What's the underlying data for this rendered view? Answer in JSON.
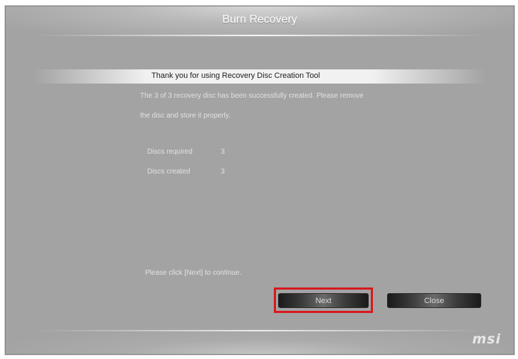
{
  "window": {
    "title": "Burn Recovery"
  },
  "content": {
    "heading": "Thank you for using Recovery Disc Creation Tool",
    "message_line1": "The 3 of 3 recovery disc has been successfully created. Please remove",
    "message_line2": "the disc and store it properly.",
    "info": [
      {
        "label": "Discs required",
        "value": "3"
      },
      {
        "label": "Discs created",
        "value": "3"
      }
    ],
    "prompt": "Please click [Next] to continue."
  },
  "buttons": {
    "next_label": "Next",
    "close_label": "Close"
  },
  "brand": {
    "logo_text": "msi"
  },
  "colors": {
    "highlight": "#d8181d",
    "background": "#a3a3a3"
  }
}
